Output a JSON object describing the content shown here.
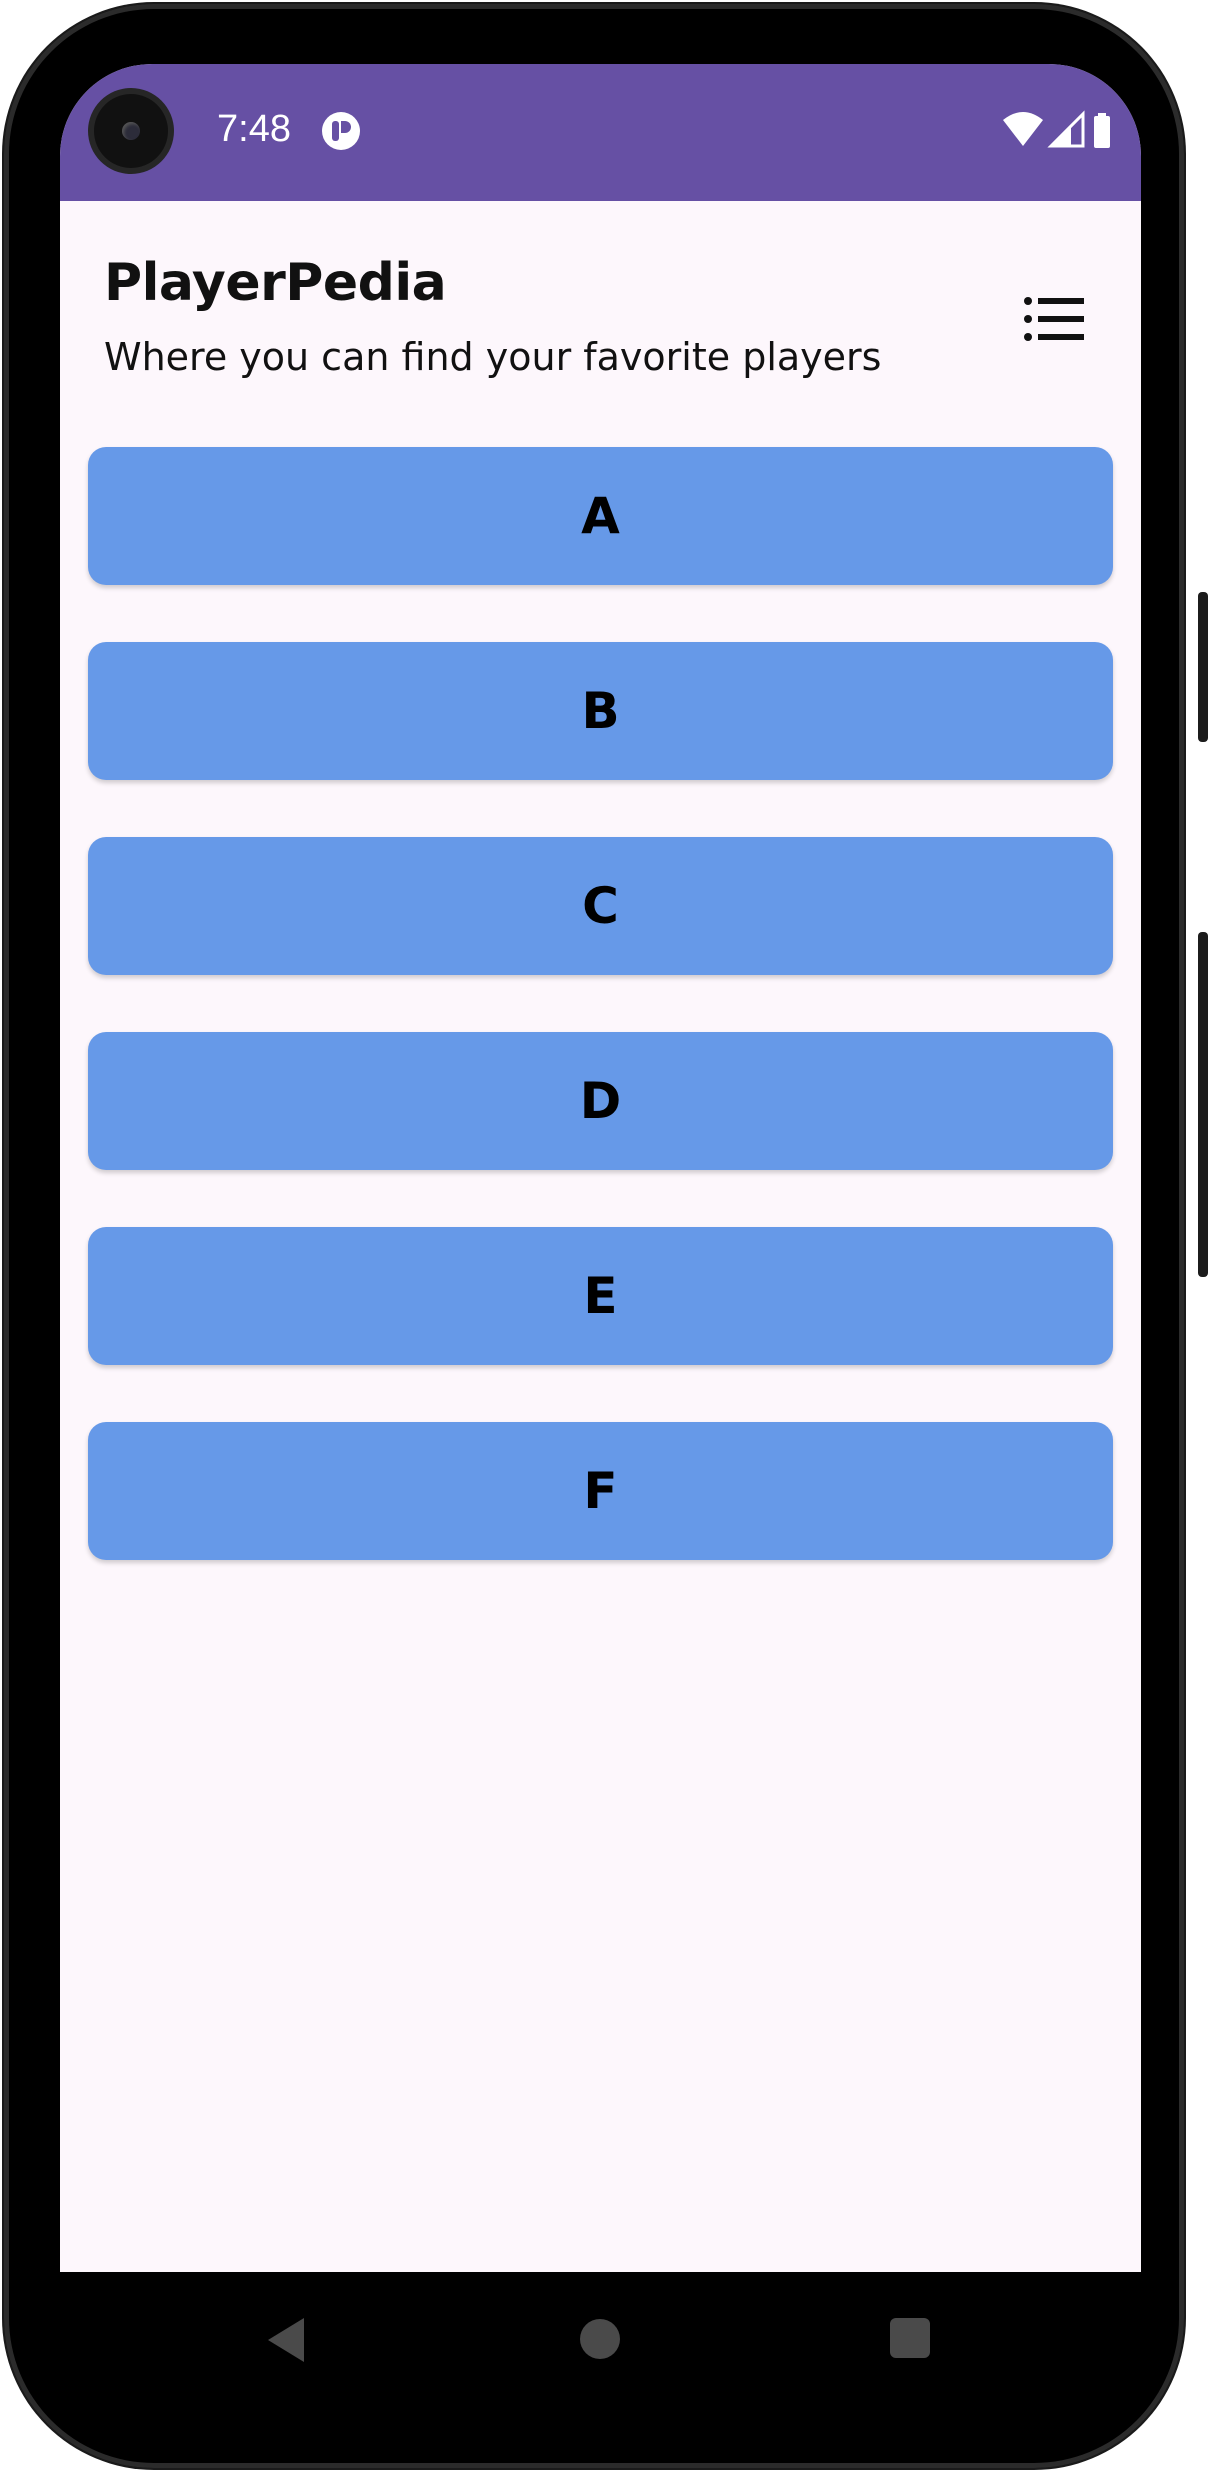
{
  "status_bar": {
    "time": "7:48",
    "background": "#6650a4",
    "icons": [
      "camera-punch-hole",
      "app-notification-icon",
      "wifi-icon",
      "signal-icon",
      "battery-icon"
    ]
  },
  "app": {
    "title": "PlayerPedia",
    "subtitle": "Where you can find your favorite players",
    "menu_icon": "list-menu-icon",
    "background": "#fdf7fc"
  },
  "letter_buttons": {
    "color": "#6699e8",
    "items": [
      "A",
      "B",
      "C",
      "D",
      "E",
      "F"
    ]
  },
  "nav_bar": {
    "buttons": [
      "back",
      "home",
      "recents"
    ]
  }
}
